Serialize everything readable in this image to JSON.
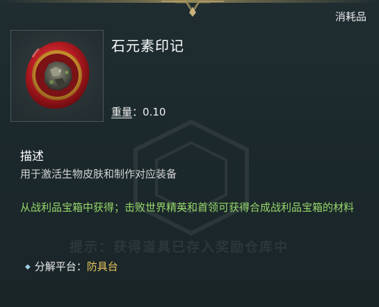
{
  "item": {
    "category": "消耗品",
    "name": "石元素印记",
    "weight_label": "重量",
    "weight_separator": "：",
    "weight_value": "0.10",
    "icon": "red-wax-seal-stone-icon"
  },
  "description": {
    "title": "描述",
    "text": "用于激活生物皮肤和制作对应装备"
  },
  "source": {
    "text": "从战利品宝箱中获得；击败世界精英和首领可获得合成战利品宝箱的材料",
    "color": "#97d86a"
  },
  "faded_hint": "提示：获得道具已存入奖励仓库中",
  "disassemble": {
    "label": "分解平台：",
    "value": "防具台",
    "value_color": "#e8c55a"
  }
}
